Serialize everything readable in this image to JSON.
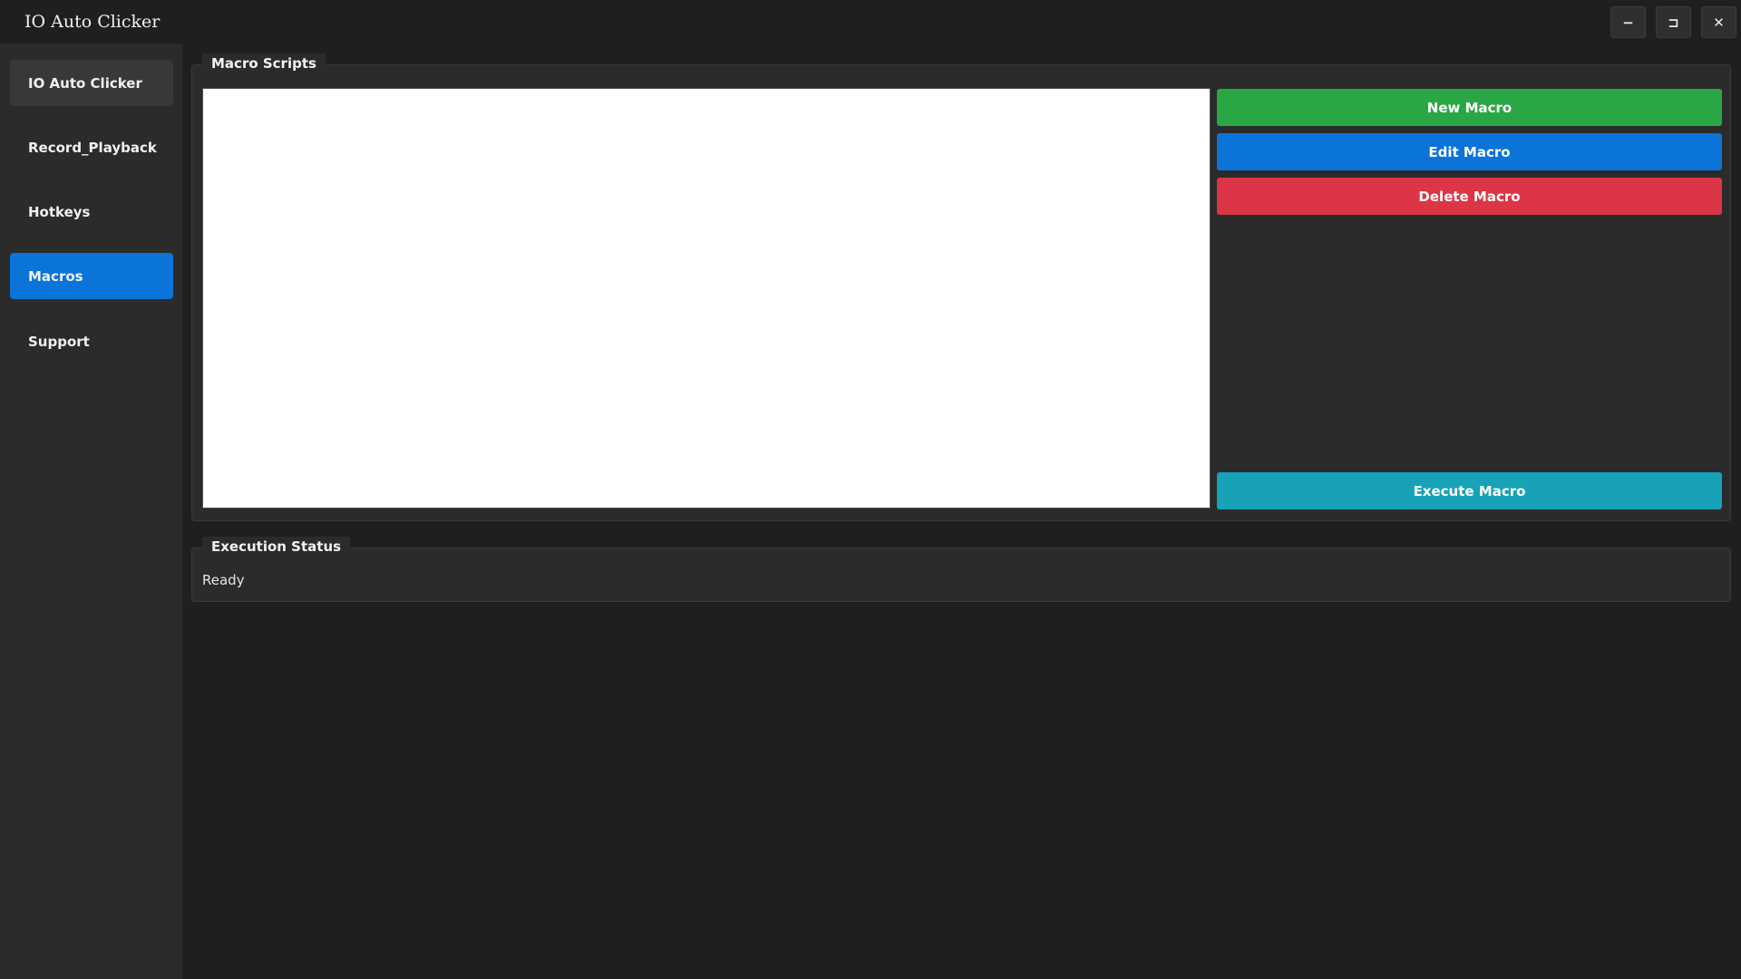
{
  "window": {
    "title": "IO Auto Clicker",
    "controls": {
      "minimize": "−",
      "maximize": "⊐",
      "close": "✕"
    }
  },
  "sidebar": {
    "items": [
      {
        "label": "IO Auto Clicker",
        "state": "hovered"
      },
      {
        "label": "Record_Playback",
        "state": "normal"
      },
      {
        "label": "Hotkeys",
        "state": "normal"
      },
      {
        "label": "Macros",
        "state": "active"
      },
      {
        "label": "Support",
        "state": "normal"
      }
    ]
  },
  "macro_scripts": {
    "group_label": "Macro Scripts",
    "script_text": "",
    "buttons": {
      "new": "New Macro",
      "edit": "Edit Macro",
      "delete": "Delete Macro",
      "execute": "Execute Macro"
    }
  },
  "execution_status": {
    "group_label": "Execution Status",
    "status": "Ready"
  },
  "colors": {
    "background": "#1f1f1f",
    "panel": "#2b2b2b",
    "accent_blue": "#0a74d9",
    "new_green": "#2aa745",
    "delete_red": "#dc3545",
    "execute_teal": "#17a2b8"
  }
}
